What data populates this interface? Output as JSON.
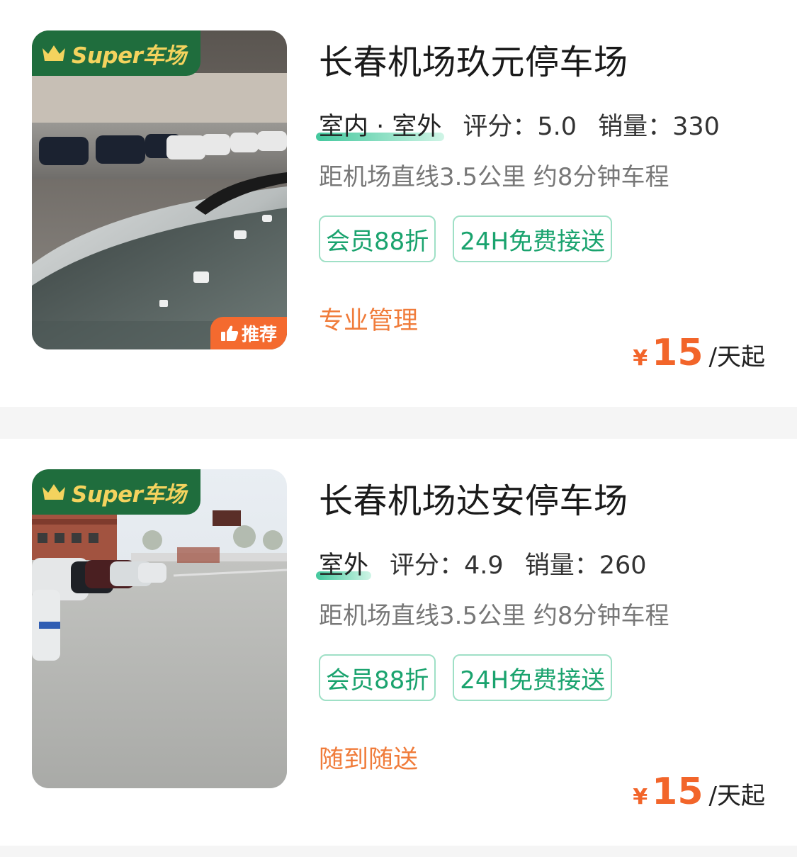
{
  "listings": [
    {
      "badge": "Super车场",
      "recommend": "推荐",
      "has_recommend": true,
      "name": "长春机场玖元停车场",
      "type": "室内 · 室外",
      "rating": "评分：5.0",
      "sales": "销量：330",
      "distance": "距机场直线3.5公里 约8分钟车程",
      "tags": [
        "会员88折",
        "24H免费接送"
      ],
      "feature": "专业管理",
      "price_currency": "¥",
      "price": "15",
      "price_unit": "/天起",
      "photo": "indoor-parking-photo"
    },
    {
      "badge": "Super车场",
      "recommend": "",
      "has_recommend": false,
      "name": "长春机场达安停车场",
      "type": "室外",
      "rating": "评分：4.9",
      "sales": "销量：260",
      "distance": "距机场直线3.5公里 约8分钟车程",
      "tags": [
        "会员88折",
        "24H免费接送"
      ],
      "feature": "随到随送",
      "price_currency": "¥",
      "price": "15",
      "price_unit": "/天起",
      "photo": "outdoor-parking-photo"
    }
  ],
  "colors": {
    "badge_bg": "#1f6d3d",
    "badge_text": "#f4d35e",
    "recommend_bg": "#f46a2f",
    "tag_border": "#9fe0c6",
    "tag_text": "#1aa36e",
    "feature_text": "#f07c3b",
    "price_text": "#f2652a"
  }
}
